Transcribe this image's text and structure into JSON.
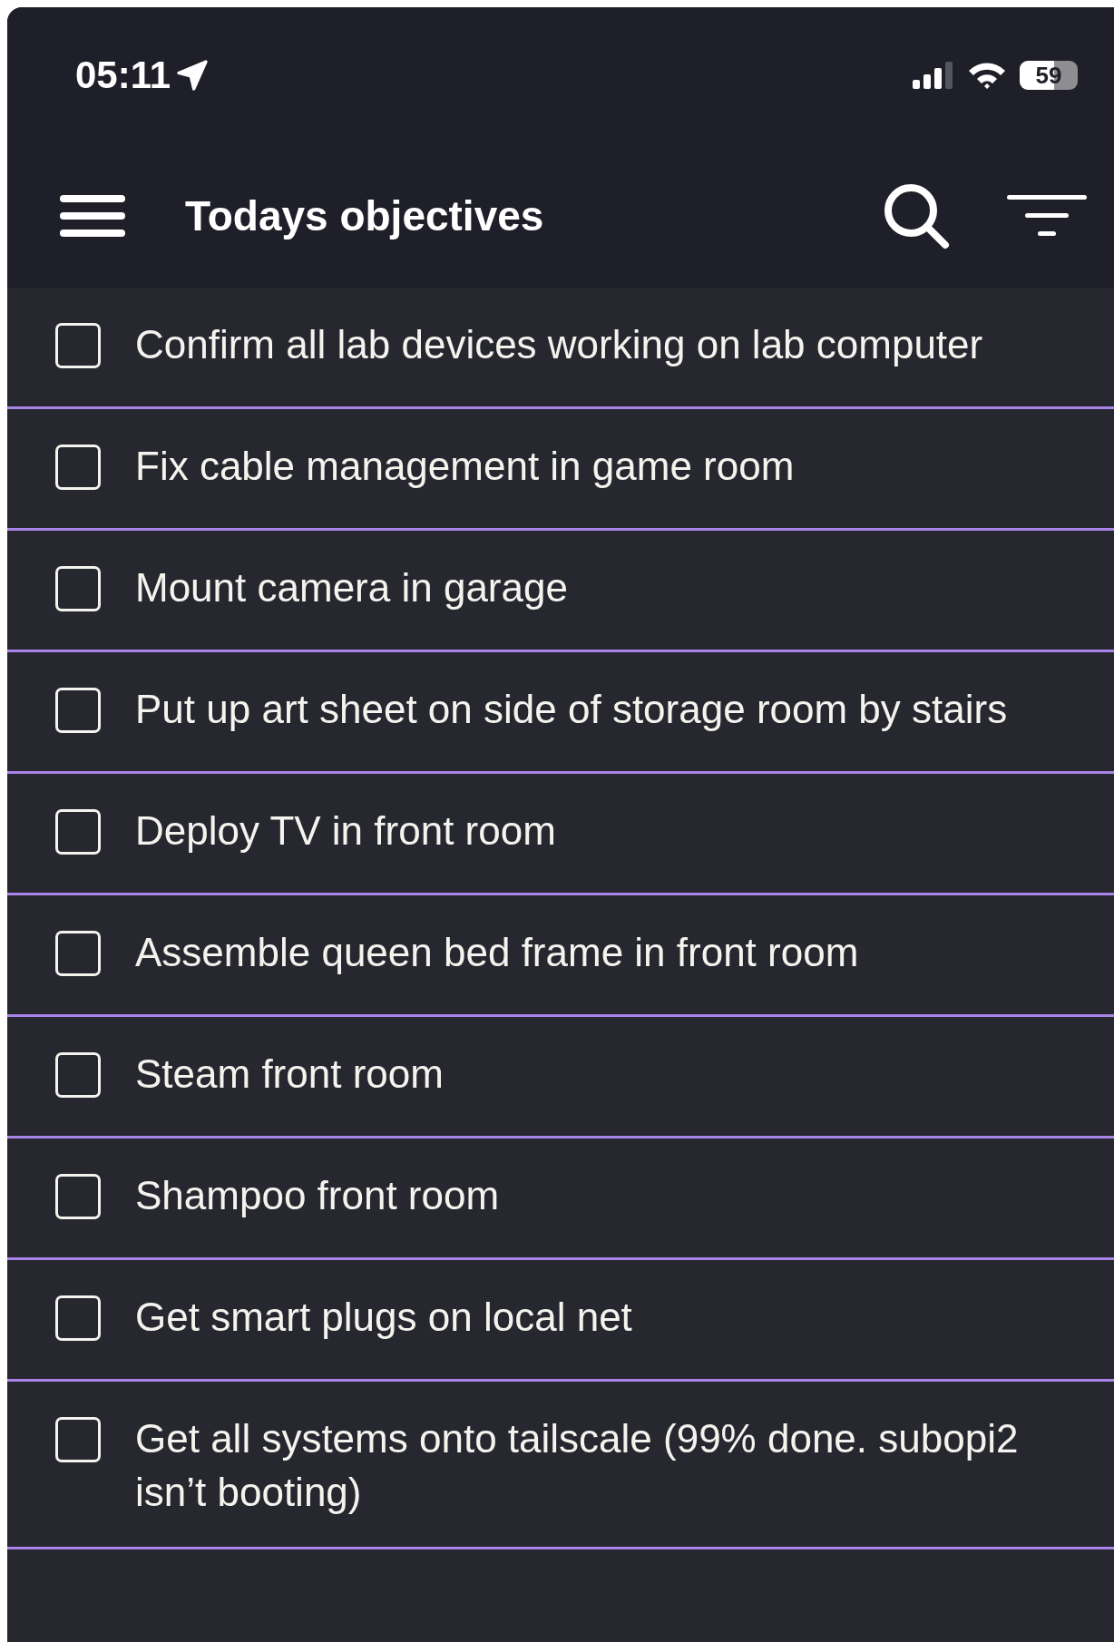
{
  "status_bar": {
    "time": "05:11",
    "battery": "59"
  },
  "header": {
    "title": "Todays objectives"
  },
  "tasks": [
    {
      "text": "Confirm all lab devices working on lab computer",
      "checked": false
    },
    {
      "text": "Fix cable management in game room",
      "checked": false
    },
    {
      "text": "Mount camera in garage",
      "checked": false
    },
    {
      "text": "Put up art sheet on side of storage room by stairs",
      "checked": false
    },
    {
      "text": "Deploy TV in front room",
      "checked": false
    },
    {
      "text": "Assemble queen bed frame in front room",
      "checked": false
    },
    {
      "text": "Steam front room",
      "checked": false
    },
    {
      "text": "Shampoo front room",
      "checked": false
    },
    {
      "text": "Get smart plugs on local net",
      "checked": false
    },
    {
      "text": "Get all systems onto tailscale (99% done. subopi2 isn’t  booting)",
      "checked": false
    }
  ]
}
